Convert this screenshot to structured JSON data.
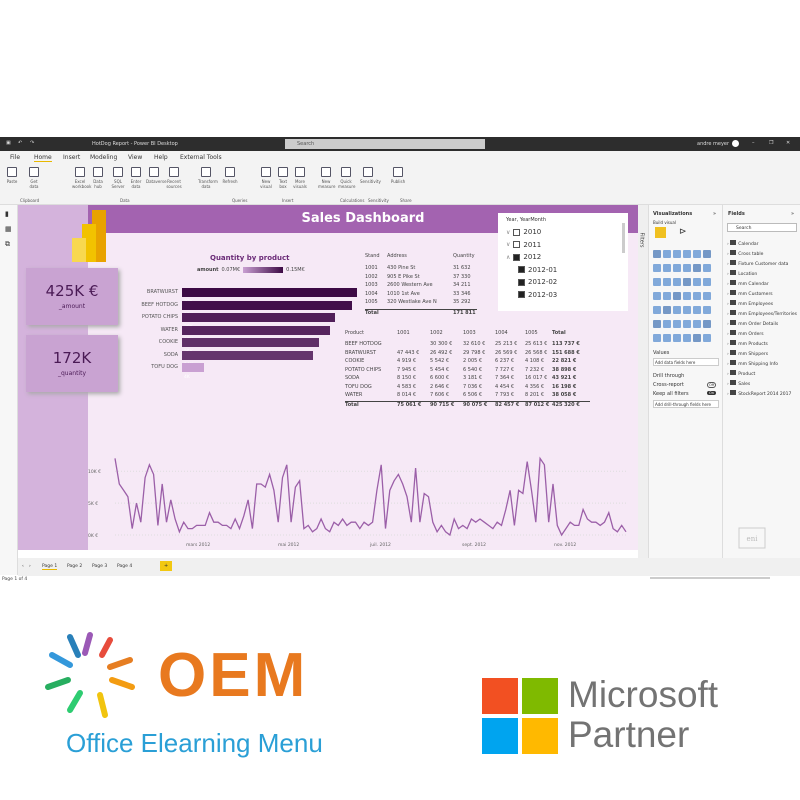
{
  "app": {
    "title": "HotDog Report - Power BI Desktop",
    "search_placeholder": "Search",
    "user": "andre meyer"
  },
  "menu": [
    "File",
    "Home",
    "Insert",
    "Modeling",
    "View",
    "Help",
    "External Tools"
  ],
  "ribbon": {
    "buttons": [
      "Paste",
      "Get data",
      "Excel workbook",
      "Data hub",
      "SQL Server",
      "Enter data",
      "Dataverse",
      "Recent sources",
      "Transform data",
      "Refresh",
      "New visual",
      "Text box",
      "More visuals",
      "New measure",
      "Quick measure",
      "Sensitivity",
      "Publish"
    ],
    "groups": [
      "Clipboard",
      "Data",
      "Queries",
      "Insert",
      "Calculations",
      "Sensitivity",
      "Share"
    ]
  },
  "dashboard": {
    "title": "Sales Dashboard",
    "kpis": [
      {
        "value": "425K €",
        "label": "_amount"
      },
      {
        "value": "172K",
        "label": "_quantity"
      }
    ],
    "bar_chart": {
      "title": "Quantity by product",
      "legend_label": "amount",
      "legend_min": "0.07M€",
      "legend_max": "0.15M€"
    },
    "store_table": {
      "headers": [
        "Stand",
        "Address",
        "Quantity"
      ],
      "rows": [
        [
          "1001",
          "430 Pine St",
          "31 632"
        ],
        [
          "1002",
          "905 E Pike St",
          "37 330"
        ],
        [
          "1003",
          "2600 Western Ave",
          "34 211"
        ],
        [
          "1004",
          "1010 1st Ave",
          "33 346"
        ],
        [
          "1005",
          "320 Westlake Ave N",
          "35 292"
        ]
      ],
      "total": [
        "Total",
        "",
        "171 811"
      ]
    },
    "matrix": {
      "headers": [
        "Product",
        "1001",
        "1002",
        "1003",
        "1004",
        "1005",
        "Total"
      ],
      "rows": [
        [
          "BEEF HOTDOG",
          "",
          "30 300 €",
          "32 610 €",
          "25 213 €",
          "25 613 €",
          "113 737 €"
        ],
        [
          "BRATWURST",
          "47 443 €",
          "26 492 €",
          "29 798 €",
          "26 569 €",
          "26 568 €",
          "151 688 €"
        ],
        [
          "COOKIE",
          "4 919 €",
          "5 542 €",
          "2 005 €",
          "6 237 €",
          "4 108 €",
          "22 821 €"
        ],
        [
          "POTATO CHIPS",
          "7 945 €",
          "5 454 €",
          "6 540 €",
          "7 727 €",
          "7 232 €",
          "38 898 €"
        ],
        [
          "SODA",
          "8 150 €",
          "6 600 €",
          "3 181 €",
          "7 364 €",
          "16 017 €",
          "43 921 €"
        ],
        [
          "TOFU DOG",
          "4 583 €",
          "2 646 €",
          "7 036 €",
          "4 454 €",
          "4 356 €",
          "16 198 €"
        ],
        [
          "WATER",
          "8 014 €",
          "7 606 €",
          "6 506 €",
          "7 793 €",
          "8 201 €",
          "38 058 €"
        ],
        [
          "Total",
          "75 061 €",
          "90 715 €",
          "90 075 €",
          "82 457 €",
          "87 012 €",
          "425 320 €"
        ]
      ]
    },
    "slicer": {
      "title": "Year, YearMonth",
      "items": [
        {
          "label": "2010",
          "checked": false,
          "expand": "down"
        },
        {
          "label": "2011",
          "checked": false,
          "expand": "down"
        },
        {
          "label": "2012",
          "checked": true,
          "expand": "up"
        },
        {
          "label": "2012-01",
          "checked": true
        },
        {
          "label": "2012-02",
          "checked": true
        },
        {
          "label": "2012-03",
          "checked": true
        }
      ]
    }
  },
  "chart_data": [
    {
      "type": "bar",
      "title": "Quantity by product",
      "categories": [
        "BRATWURST",
        "BEEF HOTDOG",
        "POTATO CHIPS",
        "WATER",
        "COOKIE",
        "SODA",
        "TOFU DOG"
      ],
      "values": [
        32,
        31,
        28,
        27,
        25,
        24,
        4
      ],
      "labels": [
        "32K",
        "31K",
        "28K",
        "27K",
        "25K",
        "24K",
        "4K"
      ],
      "color_scale": [
        "#c9a0d2",
        "#3d0a45"
      ]
    },
    {
      "type": "line",
      "yticks": [
        "0K €",
        "5K €",
        "10K €"
      ],
      "ylim": [
        0,
        12.5
      ],
      "xticks": [
        "mars 2012",
        "mai 2012",
        "juil. 2012",
        "sept. 2012",
        "nov. 2012"
      ],
      "color": "#9b5fa8",
      "values": [
        12,
        8,
        7,
        6,
        1,
        5,
        2,
        9,
        11,
        9.5,
        1.5,
        8,
        2,
        5.5,
        2.5,
        0.5,
        2,
        1,
        1,
        1.5,
        1.5,
        1.5,
        3.5,
        2,
        2,
        1.5,
        1.5,
        1,
        2.5,
        1,
        3,
        5.5,
        1,
        8,
        8,
        7.5,
        9.5,
        7,
        2,
        9,
        11,
        2,
        7.5,
        8.5,
        1,
        1.5,
        0.5,
        1,
        2.5,
        1,
        0.5,
        2,
        1.5,
        2.5,
        1.5,
        2,
        2,
        1,
        2,
        1.5,
        2,
        7,
        11,
        1,
        7,
        8.5,
        9.5,
        8,
        6,
        2,
        10.5,
        2,
        6.5,
        6,
        2,
        0.5,
        1.5,
        0.5,
        0,
        2.5,
        1,
        1.5,
        1,
        2.5,
        2,
        2.5,
        2,
        1.5,
        1,
        2,
        1.5,
        4,
        7,
        1.5,
        7,
        6.5,
        11.5,
        7,
        2,
        12,
        11,
        2,
        8,
        1.5,
        0,
        1,
        2,
        1.5,
        1.5,
        4,
        2.5,
        2,
        2,
        1.5,
        2,
        3.5,
        1,
        0.5,
        1.5,
        0.5
      ]
    }
  ],
  "visualizations": {
    "title": "Visualizations",
    "subtitle": "Build visual",
    "values_label": "Values",
    "values_placeholder": "Add data fields here",
    "drill_through": "Drill through",
    "cross_report": "Cross-report",
    "cross_report_state": "Off",
    "keep_all_filters": "Keep all filters",
    "keep_all_filters_state": "On",
    "drill_placeholder": "Add drill-through fields here"
  },
  "filters": {
    "label": "Filters"
  },
  "fields": {
    "title": "Fields",
    "search_placeholder": "Search",
    "items": [
      "Calendar",
      "Cross table",
      "Fixture Customer data",
      "Location",
      "mm Calendar",
      "mm Customers",
      "mm Employees",
      "mm Employees/Territories",
      "mm Order Details",
      "mm Orders",
      "mm Products",
      "mm Shippers",
      "mm Shipping Info",
      "Product",
      "Sales",
      "StockReport 2014 2017"
    ]
  },
  "pages": {
    "tabs": [
      "Page 1",
      "Page 2",
      "Page 3",
      "Page 4"
    ],
    "add": "+",
    "status": "Page 1 of 4"
  },
  "logos": {
    "oem": {
      "big": "OEM",
      "sub": "Office Elearning Menu"
    },
    "microsoft": {
      "line1": "Microsoft",
      "line2": "Partner"
    }
  }
}
